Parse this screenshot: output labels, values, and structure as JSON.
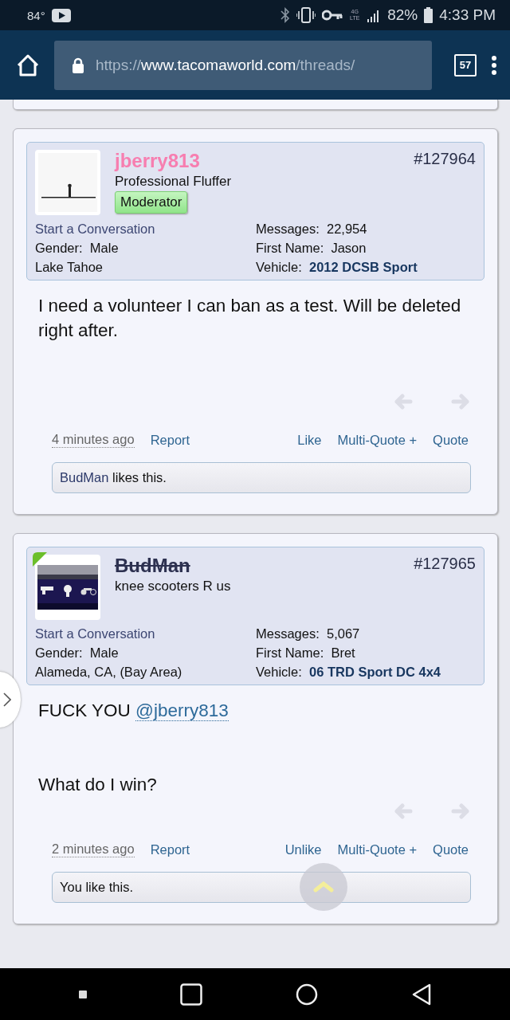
{
  "status_bar": {
    "temperature": "84°",
    "network": "4G LTE",
    "battery": "82%",
    "time": "4:33 PM"
  },
  "browser": {
    "url_scheme": "https://",
    "url_host": "www.tacomaworld.com",
    "url_path": "/threads/",
    "tab_count": "57"
  },
  "posts": [
    {
      "username": "jberry813",
      "kind": "moderator",
      "user_title": "Professional Fluffer",
      "badge": "Moderator",
      "online": false,
      "avatar": {
        "kind": "picture"
      },
      "post_number": "#127964",
      "start_conversation": "Start a Conversation",
      "gender_label": "Gender:",
      "gender": "Male",
      "location": "Lake Tahoe",
      "messages_label": "Messages:",
      "messages": "22,954",
      "first_name_label": "First Name:",
      "first_name": "Jason",
      "vehicle_label": "Vehicle:",
      "vehicle": "2012 DCSB Sport",
      "body": [
        {
          "text": "I need a volunteer I can ban as a test. Will be deleted right after."
        }
      ],
      "date": "4 minutes ago",
      "report": "Report",
      "like": "Like",
      "multi_quote": "Multi-Quote +",
      "quote": "Quote",
      "likes": {
        "liker": "BudMan",
        "text": " likes this."
      }
    },
    {
      "username": "BudMan",
      "kind": "banned",
      "user_title": "knee scooters R us",
      "online": true,
      "avatar": {
        "kind": "picture"
      },
      "post_number": "#127965",
      "start_conversation": "Start a Conversation",
      "gender_label": "Gender:",
      "gender": "Male",
      "location": "Alameda, CA, (Bay Area)",
      "messages_label": "Messages:",
      "messages": "5,067",
      "first_name_label": "First Name:",
      "first_name": "Bret",
      "vehicle_label": "Vehicle:",
      "vehicle": "06 TRD Sport DC 4x4",
      "body": [
        {
          "text": "FUCK YOU ",
          "mention": "@jberry813"
        },
        {
          "text": "What do I win?"
        }
      ],
      "date": "2 minutes ago",
      "report": "Report",
      "like": "Unlike",
      "multi_quote": "Multi-Quote +",
      "quote": "Quote",
      "likes": {
        "text": "You like this."
      }
    }
  ]
}
